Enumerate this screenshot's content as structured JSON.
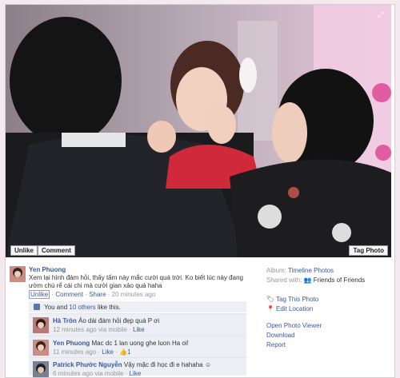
{
  "photo": {
    "unlike_label": "Unlike",
    "comment_label": "Comment",
    "tag_label": "Tag Photo"
  },
  "post": {
    "author": "Yen Phuong",
    "caption": "Xem lại hình đám hỏi, thấy tấm này mắc cười quá trời. Ko biết lúc này đang ườm chú rể cái chi mà cười gian xảo quá haha",
    "unlike": "Unlike",
    "comment": "Comment",
    "share": "Share",
    "time": "20 minutes ago",
    "likes": {
      "prefix": "You and",
      "others": "10 others",
      "suffix": "like this."
    }
  },
  "comments": [
    {
      "name": "Hà Trôn",
      "text": "Áo dài đám hỏi đẹp quá P ơi",
      "time": "12 minutes ago via mobile",
      "like": "Like",
      "count": ""
    },
    {
      "name": "Yen Phuong",
      "text": "Mac dc 1 lan uong ghe luon Ha oi!",
      "time": "11 minutes ago",
      "like": "Like",
      "count": "1"
    },
    {
      "name": "Patrick Phước Nguyễn",
      "text": "Vậy mặc đi học đi e hahaha",
      "time": "6 minutes ago via mobile",
      "like": "Like",
      "count": ""
    }
  ],
  "sidebar": {
    "album_label": "Album:",
    "album_value": "Timeline Photos",
    "shared_label": "Shared with:",
    "shared_value": "Friends of Friends",
    "tag_this_photo": "Tag This Photo",
    "edit_location": "Edit Location",
    "open_viewer": "Open Photo Viewer",
    "download": "Download",
    "report": "Report"
  },
  "icons": {
    "expand": "expand-icon",
    "tag": "tag-icon",
    "location": "location-pin-icon",
    "friends": "friends-icon",
    "like": "thumbs-up-icon"
  },
  "colors": {
    "link": "#3b5998",
    "likes_bg": "#edeff4",
    "page_bg": "#f4e9ef"
  }
}
